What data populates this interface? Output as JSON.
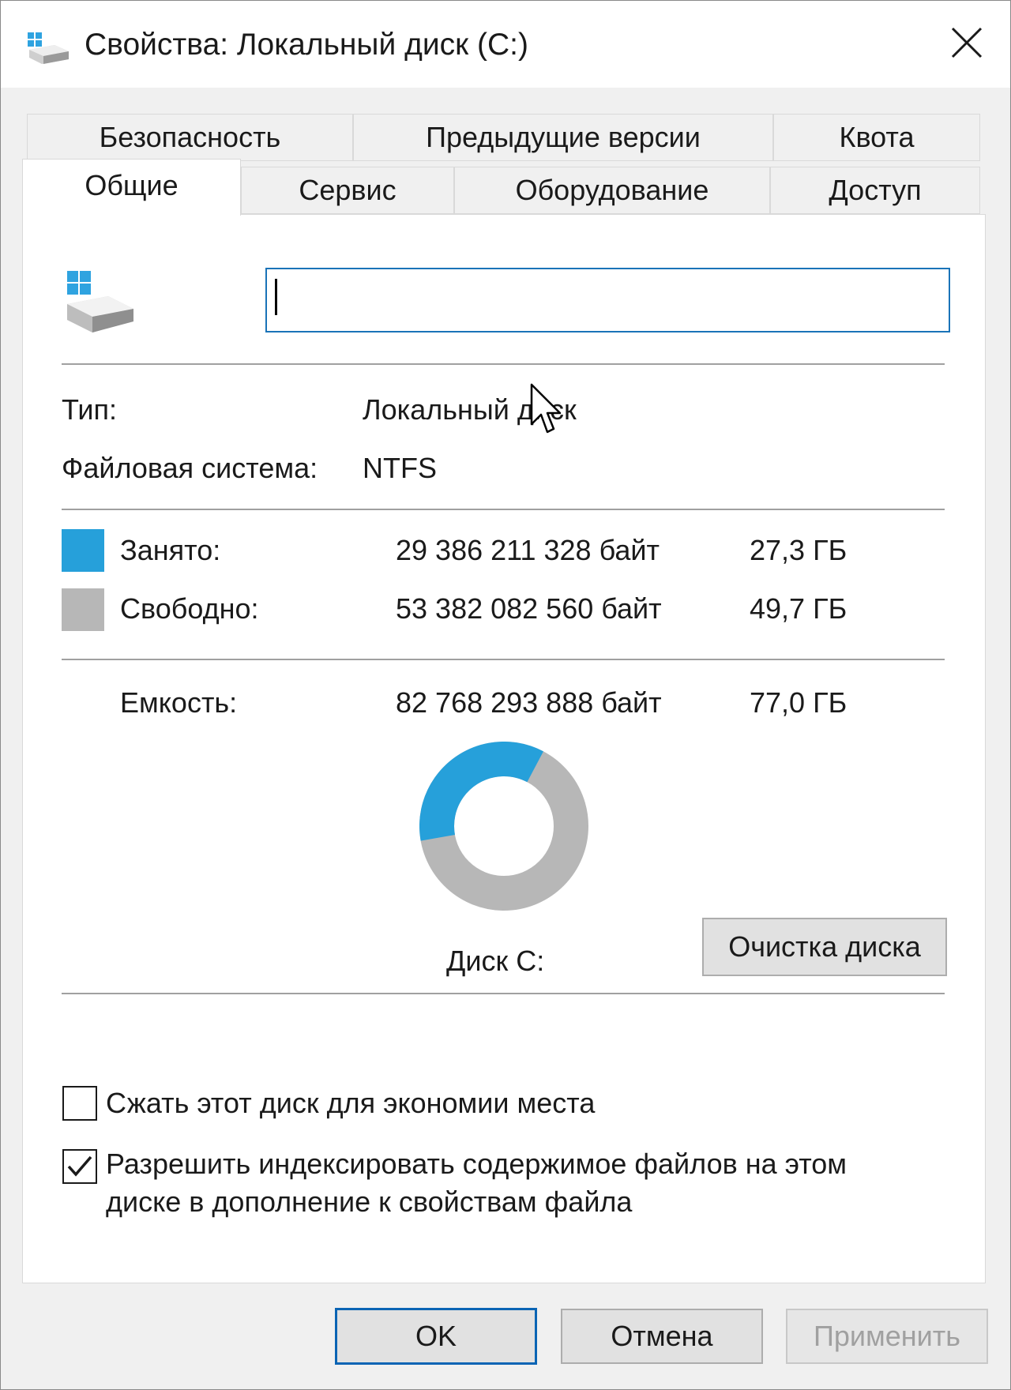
{
  "window": {
    "title": "Свойства: Локальный диск (C:)"
  },
  "tabs": {
    "row1": [
      "Безопасность",
      "Предыдущие версии",
      "Квота"
    ],
    "row2": [
      "Общие",
      "Сервис",
      "Оборудование",
      "Доступ"
    ],
    "active": "Общие"
  },
  "general": {
    "drive_icon": "drive-icon",
    "name_value": "",
    "type_label": "Тип:",
    "type_value": "Локальный диск",
    "fs_label": "Файловая система:",
    "fs_value": "NTFS",
    "used": {
      "label": "Занято:",
      "bytes": "29 386 211 328 байт",
      "size": "27,3 ГБ",
      "color": "#26a0da"
    },
    "free": {
      "label": "Свободно:",
      "bytes": "53 382 082 560 байт",
      "size": "49,7 ГБ",
      "color": "#b7b7b7"
    },
    "capacity": {
      "label": "Емкость:",
      "bytes": "82 768 293 888 байт",
      "size": "77,0 ГБ"
    },
    "used_fraction": 0.355,
    "disk_label": "Диск C:",
    "cleanup_button": "Очистка диска",
    "compress_label": "Сжать этот диск для экономии места",
    "compress_checked": false,
    "index_label_line1": "Разрешить индексировать содержимое файлов на этом",
    "index_label_line2": "диске в дополнение к свойствам файла",
    "index_checked": true
  },
  "footer": {
    "ok": "OK",
    "cancel": "Отмена",
    "apply": "Применить"
  }
}
